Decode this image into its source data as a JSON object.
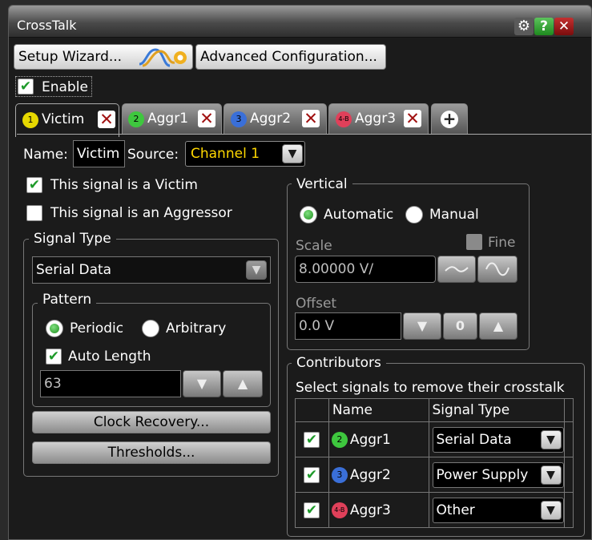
{
  "window": {
    "title": "CrossTalk"
  },
  "titlebar": {
    "gear_icon": "gear-icon",
    "help_label": "?",
    "close_label": "✕"
  },
  "toolbar": {
    "setup_wizard_label": "Setup Wizard...",
    "advanced_config_label": "Advanced Configuration..."
  },
  "enable": {
    "label": "Enable",
    "checked": true
  },
  "tabs": [
    {
      "label": "Victim",
      "badge": "1",
      "color": "#e6d800"
    },
    {
      "label": "Aggr1",
      "badge": "2",
      "color": "#3ec73e"
    },
    {
      "label": "Aggr2",
      "badge": "3",
      "color": "#3a6fd8"
    },
    {
      "label": "Aggr3",
      "badge": "4-B",
      "color": "#e0405a"
    }
  ],
  "add_tab_icon": "plus-icon",
  "victim": {
    "name_label": "Name:",
    "name_value": "Victim",
    "source_label": "Source:",
    "source_value": "Channel 1",
    "is_victim_label": "This signal is a Victim",
    "is_victim_checked": true,
    "is_aggressor_label": "This signal is an Aggressor",
    "is_aggressor_checked": false
  },
  "signal_type": {
    "legend": "Signal Type",
    "value": "Serial Data",
    "pattern_legend": "Pattern",
    "periodic_label": "Periodic",
    "arbitrary_label": "Arbitrary",
    "selected": "Periodic",
    "auto_length_label": "Auto Length",
    "auto_length_checked": true,
    "length_value": "63",
    "clock_recovery_label": "Clock Recovery...",
    "thresholds_label": "Thresholds..."
  },
  "vertical": {
    "legend": "Vertical",
    "automatic_label": "Automatic",
    "manual_label": "Manual",
    "selected": "Automatic",
    "scale_label": "Scale",
    "fine_label": "Fine",
    "scale_value": "8.00000 V/",
    "offset_label": "Offset",
    "offset_value": "0.0 V"
  },
  "contributors": {
    "legend": "Contributors",
    "instruction": "Select signals to remove their crosstalk",
    "columns": [
      "Name",
      "Signal Type"
    ],
    "rows": [
      {
        "checked": true,
        "badge": "2",
        "color": "#3ec73e",
        "name": "Aggr1",
        "signal_type": "Serial Data"
      },
      {
        "checked": true,
        "badge": "3",
        "color": "#3a6fd8",
        "name": "Aggr2",
        "signal_type": "Power Supply"
      },
      {
        "checked": true,
        "badge": "4-B",
        "color": "#e0405a",
        "name": "Aggr3",
        "signal_type": "Other"
      }
    ]
  },
  "colors": {
    "accent_yellow": "#ffd800",
    "check_green": "#1e9a2a",
    "close_red": "#a01010"
  }
}
